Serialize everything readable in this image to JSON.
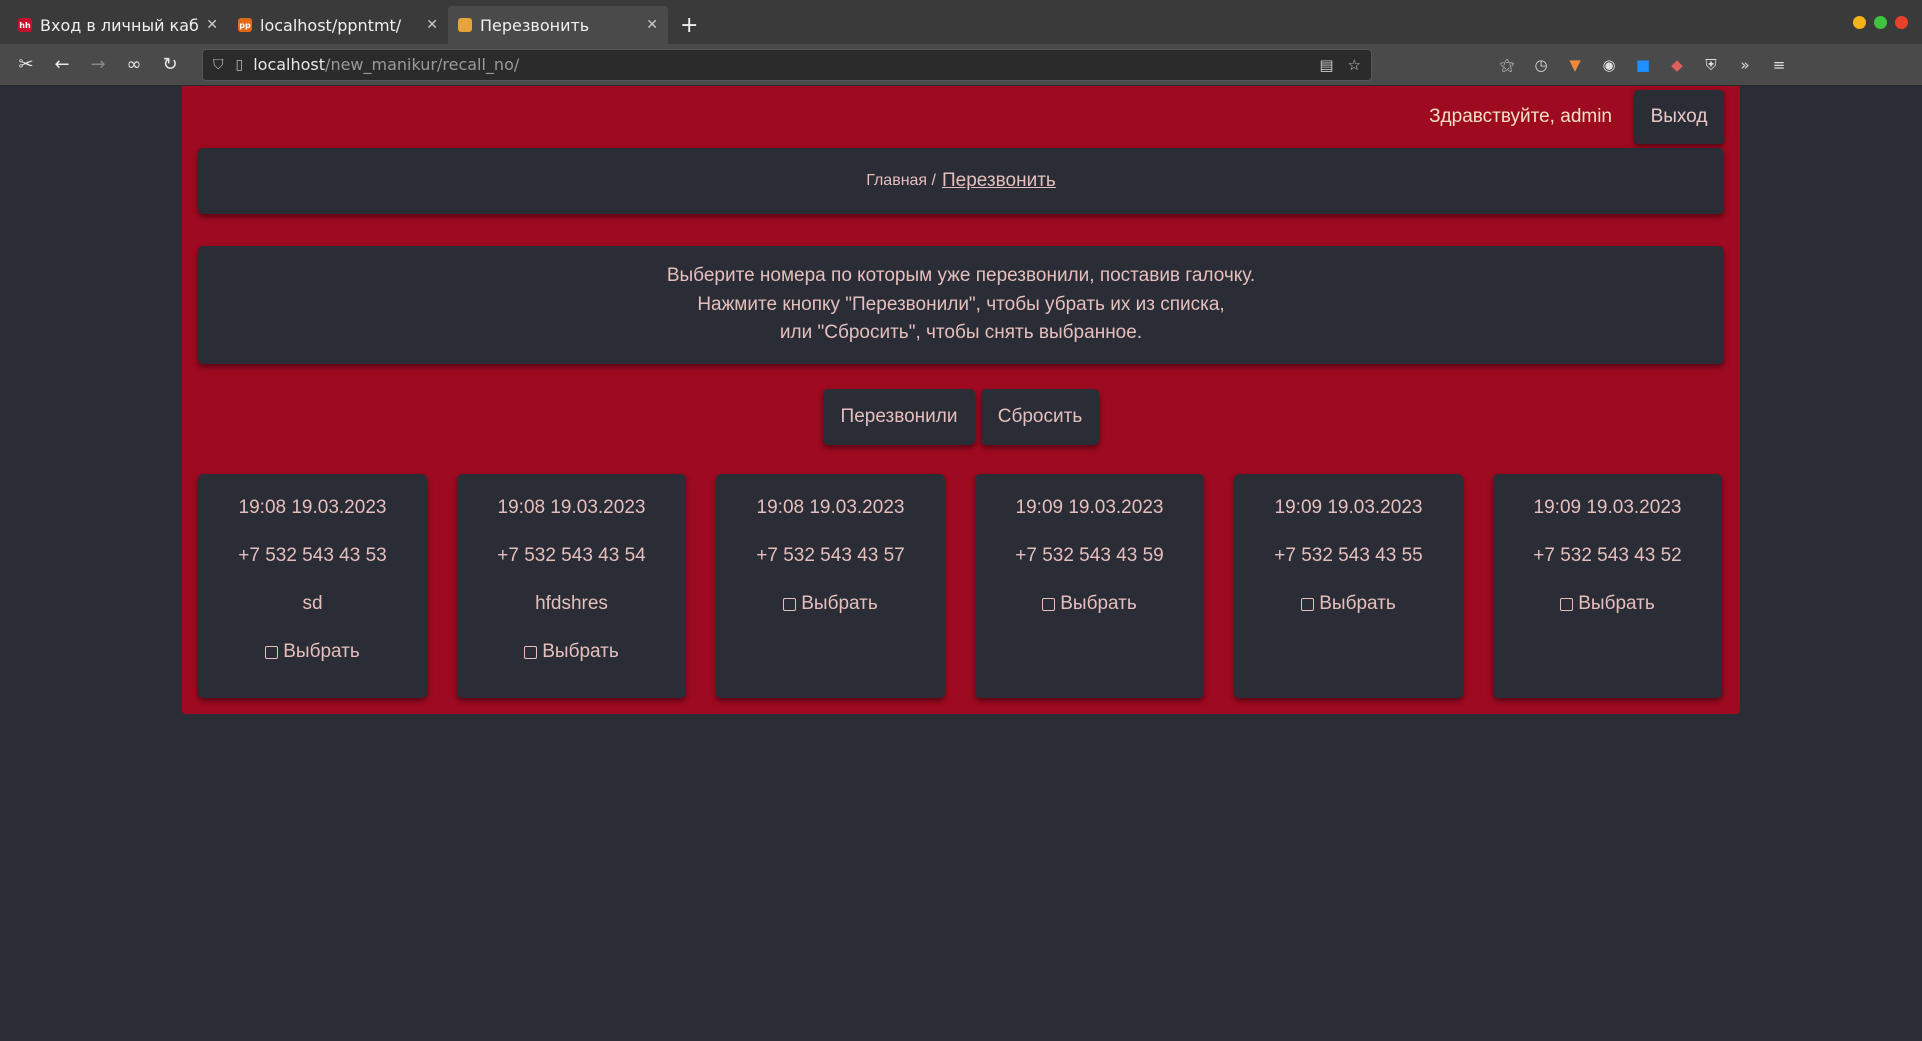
{
  "browser": {
    "tabs": [
      {
        "title": "Вход в личный кабинет",
        "favicon_color": "#c8102e",
        "favicon_text": "hh"
      },
      {
        "title": "localhost/ppntmt/",
        "favicon_color": "#e06a1a",
        "favicon_text": "pp"
      },
      {
        "title": "Перезвонить",
        "favicon_color": "#e8a23a",
        "favicon_text": ""
      }
    ],
    "url_host": "localhost",
    "url_path": "/new_manikur/recall_no/"
  },
  "header": {
    "greeting": "Здравствуйте,",
    "username": "admin",
    "logout_label": "Выход"
  },
  "breadcrumb": {
    "home": "Главная /",
    "current": "Перезвонить"
  },
  "instructions": [
    "Выберите номера по которым уже перезвонили, поставив галочку.",
    "Нажмите кнопку \"Перезвонили\", чтобы убрать их из списка,",
    "или \"Сбросить\", чтобы снять выбранное."
  ],
  "actions": {
    "called_label": "Перезвонили",
    "reset_label": "Сбросить"
  },
  "select_label": "Выбрать",
  "records": [
    {
      "datetime": "19:08 19.03.2023",
      "phone": "+7 532 543 43 53",
      "name": "sd"
    },
    {
      "datetime": "19:08 19.03.2023",
      "phone": "+7 532 543 43 54",
      "name": "hfdshres"
    },
    {
      "datetime": "19:08 19.03.2023",
      "phone": "+7 532 543 43 57",
      "name": ""
    },
    {
      "datetime": "19:09 19.03.2023",
      "phone": "+7 532 543 43 59",
      "name": ""
    },
    {
      "datetime": "19:09 19.03.2023",
      "phone": "+7 532 543 43 55",
      "name": ""
    },
    {
      "datetime": "19:09 19.03.2023",
      "phone": "+7 532 543 43 52",
      "name": ""
    }
  ],
  "colors": {
    "panel": "#9e0a20",
    "card": "#2a2d36",
    "text": "#e6bfbd"
  }
}
